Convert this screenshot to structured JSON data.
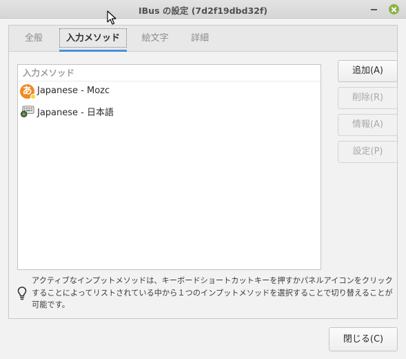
{
  "window": {
    "title": "IBus の設定 (7d2f19dbd32f)"
  },
  "tabs": [
    {
      "label": "全般"
    },
    {
      "label": "入力メソッド",
      "active": true
    },
    {
      "label": "絵文字"
    },
    {
      "label": "詳細"
    }
  ],
  "input_methods": {
    "header": "入力メソッド",
    "items": [
      {
        "label": "Japanese - Mozc",
        "icon": "mozc-hiragana-icon",
        "icon_glyph": "あ"
      },
      {
        "label": "Japanese - 日本語",
        "icon": "keyboard-icon"
      }
    ]
  },
  "side_buttons": {
    "add": "追加(A)",
    "remove": "削除(R)",
    "info": "情報(A)",
    "settings": "設定(P)"
  },
  "info_text": "アクティブなインプットメソッドは、キーボードショートカットキーを押すかパネルアイコンをクリックすることによってリストされている中から１つのインプットメソッドを選択することで切り替えることが可能です。",
  "footer": {
    "close": "閉じる(C)"
  },
  "colors": {
    "accent": "#4a90d9",
    "close_button": "#8ab346",
    "mozc_icon": "#f08a24"
  }
}
